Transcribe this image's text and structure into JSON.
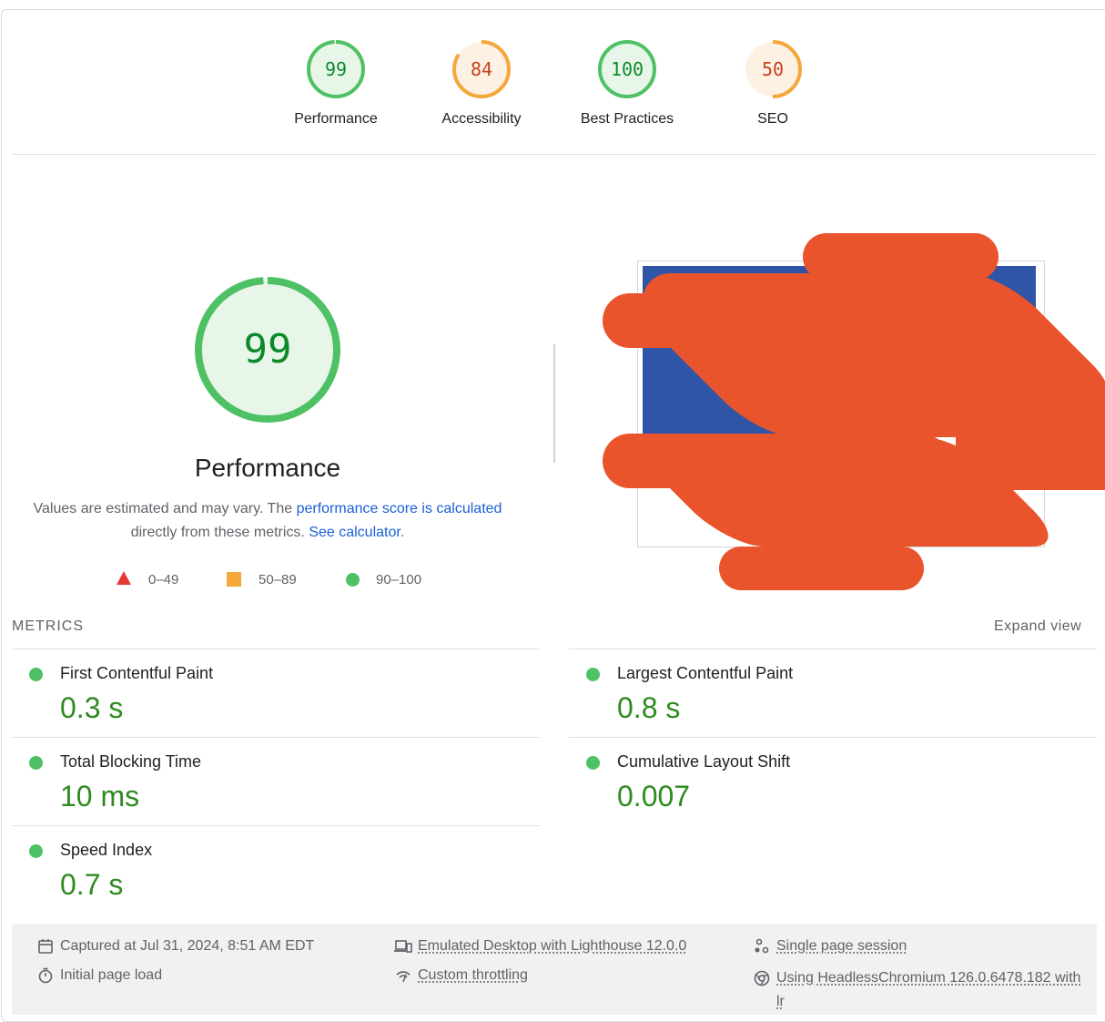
{
  "gauges": [
    {
      "score": "99",
      "label": "Performance",
      "fraction": 0.99,
      "color": "#0c8a2a",
      "ring": "#4fc165",
      "fill": "#e8f6ea"
    },
    {
      "score": "84",
      "label": "Accessibility",
      "fraction": 0.84,
      "color": "#c6421b",
      "ring": "#f4a73b",
      "fill": "#fdf1e4"
    },
    {
      "score": "100",
      "label": "Best Practices",
      "fraction": 1.0,
      "color": "#0c8a2a",
      "ring": "#4fc165",
      "fill": "#e8f6ea"
    },
    {
      "score": "50",
      "label": "SEO",
      "fraction": 0.5,
      "color": "#c6421b",
      "ring": "#f4a73b",
      "fill": "#fdf1e4"
    }
  ],
  "performance": {
    "score": "99",
    "fraction": 0.99,
    "title": "Performance",
    "desc_prefix": "Values are estimated and may vary. The ",
    "desc_link1": "performance score is calculated",
    "desc_middle": " directly from these metrics. ",
    "desc_link2": "See calculator",
    "desc_suffix": "."
  },
  "legend": {
    "fail": "0–49",
    "average": "50–89",
    "pass": "90–100"
  },
  "metrics": {
    "heading": "METRICS",
    "expand_label": "Expand view",
    "items": [
      {
        "name": "First Contentful Paint",
        "value": "0.3 s"
      },
      {
        "name": "Largest Contentful Paint",
        "value": "0.8 s"
      },
      {
        "name": "Total Blocking Time",
        "value": "10 ms"
      },
      {
        "name": "Cumulative Layout Shift",
        "value": "0.007"
      },
      {
        "name": "Speed Index",
        "value": "0.7 s"
      }
    ]
  },
  "footer": {
    "captured": "Captured at Jul 31, 2024, 8:51 AM EDT",
    "initial_load": "Initial page load",
    "emulated": "Emulated Desktop with Lighthouse 12.0.0",
    "throttling": "Custom throttling",
    "session": "Single page session",
    "browser": "Using HeadlessChromium 126.0.6478.182 with lr"
  },
  "colors": {
    "pass": "#4fc165",
    "average": "#f4a73b",
    "fail": "#e53935",
    "metric_value": "#2e8b1e",
    "link": "#1a5fd6"
  }
}
